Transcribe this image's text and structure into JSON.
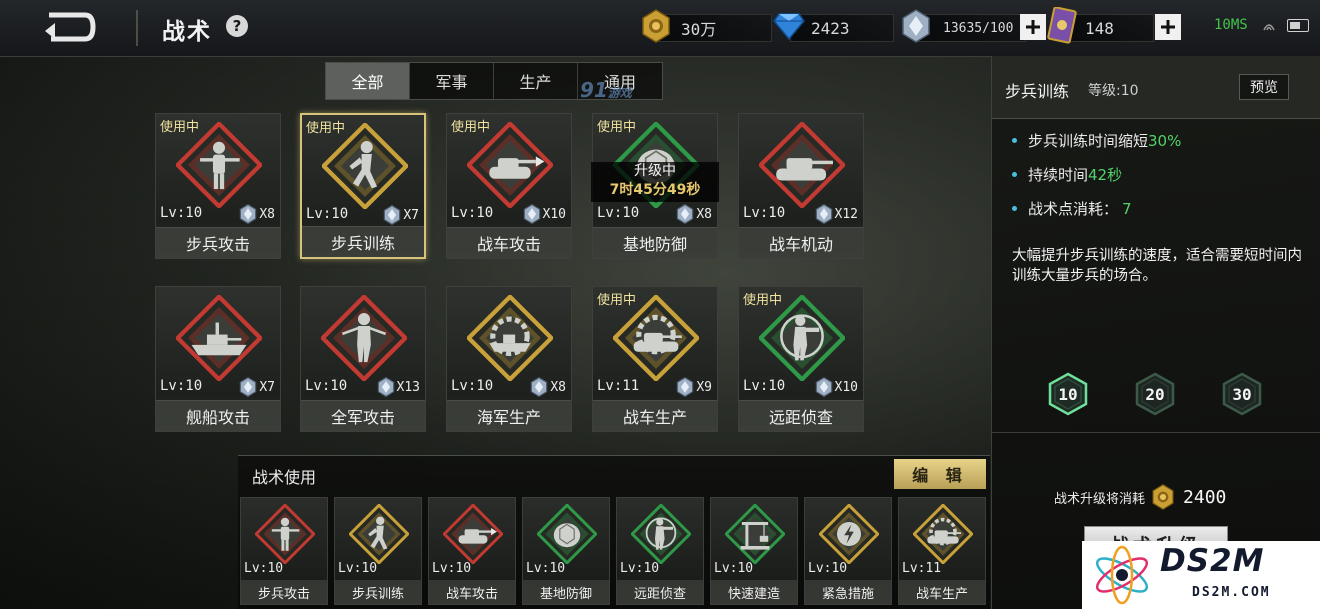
{
  "header": {
    "title": "战术",
    "help_label": "?",
    "resources": {
      "gold": "30万",
      "diamond": "2423",
      "crystal": "13635/100",
      "cards": "148"
    },
    "latency": "10MS"
  },
  "tabs": [
    {
      "label": "全部",
      "active": true
    },
    {
      "label": "军事",
      "active": false
    },
    {
      "label": "生产",
      "active": false
    },
    {
      "label": "通用",
      "active": false
    }
  ],
  "watermark_91": {
    "main": "91",
    "sub": "游戏"
  },
  "tactics": [
    {
      "name": "步兵攻击",
      "lv": "Lv:10",
      "cost": "X8",
      "in_use": "使用中",
      "frame": "red",
      "icon": "soldier-rifle-icon",
      "selected": false
    },
    {
      "name": "步兵训练",
      "lv": "Lv:10",
      "cost": "X7",
      "in_use": "使用中",
      "frame": "gold",
      "icon": "running-soldier-icon",
      "selected": true
    },
    {
      "name": "战车攻击",
      "lv": "Lv:10",
      "cost": "X10",
      "in_use": "使用中",
      "frame": "red",
      "icon": "tank-fire-icon",
      "selected": false
    },
    {
      "name": "基地防御",
      "lv": "Lv:10",
      "cost": "X8",
      "in_use": "使用中",
      "frame": "green",
      "icon": "turtle-shield-icon",
      "selected": false,
      "upgrading": {
        "label": "升级中",
        "timer": "7时45分49秒"
      }
    },
    {
      "name": "战车机动",
      "lv": "Lv:10",
      "cost": "X12",
      "in_use": "",
      "frame": "red",
      "icon": "tank-icon",
      "selected": false
    },
    {
      "name": "舰船攻击",
      "lv": "Lv:10",
      "cost": "X7",
      "in_use": "",
      "frame": "red",
      "icon": "warship-icon",
      "selected": false
    },
    {
      "name": "全军攻击",
      "lv": "Lv:10",
      "cost": "X13",
      "in_use": "",
      "frame": "red",
      "icon": "soldier-woman-icon",
      "selected": false
    },
    {
      "name": "海军生产",
      "lv": "Lv:10",
      "cost": "X8",
      "in_use": "",
      "frame": "gold",
      "icon": "ship-gear-icon",
      "selected": false
    },
    {
      "name": "战车生产",
      "lv": "Lv:11",
      "cost": "X9",
      "in_use": "使用中",
      "frame": "gold",
      "icon": "tank-gear-icon",
      "selected": false
    },
    {
      "name": "远距侦查",
      "lv": "Lv:10",
      "cost": "X10",
      "in_use": "使用中",
      "frame": "green",
      "icon": "scout-soldier-icon",
      "selected": false
    }
  ],
  "usage": {
    "title": "战术使用",
    "edit_label": "编 辑",
    "slots": [
      {
        "name": "步兵攻击",
        "lv": "Lv:10",
        "frame": "red",
        "icon": "soldier-rifle-icon"
      },
      {
        "name": "步兵训练",
        "lv": "Lv:10",
        "frame": "gold",
        "icon": "running-soldier-icon"
      },
      {
        "name": "战车攻击",
        "lv": "Lv:10",
        "frame": "red",
        "icon": "tank-fire-icon"
      },
      {
        "name": "基地防御",
        "lv": "Lv:10",
        "frame": "green",
        "icon": "turtle-shield-icon"
      },
      {
        "name": "远距侦查",
        "lv": "Lv:10",
        "frame": "green",
        "icon": "scout-soldier-icon"
      },
      {
        "name": "快速建造",
        "lv": "Lv:10",
        "frame": "green",
        "icon": "crane-icon"
      },
      {
        "name": "紧急措施",
        "lv": "Lv:10",
        "frame": "gold",
        "icon": "lightning-shield-icon"
      },
      {
        "name": "战车生产",
        "lv": "Lv:11",
        "frame": "gold",
        "icon": "tank-gear-icon"
      }
    ]
  },
  "detail": {
    "name": "步兵训练",
    "level_label": "等级:10",
    "preview_label": "预览",
    "effects": [
      {
        "text": "步兵训练时间缩短",
        "highlight": "30%"
      },
      {
        "text": "持续时间",
        "highlight": "42秒"
      },
      {
        "text": "战术点消耗：",
        "highlight": "7"
      }
    ],
    "description": "大幅提升步兵训练的速度，适合需要短时间内训练大量步兵的场合。",
    "level_buttons": [
      "10",
      "20",
      "30"
    ],
    "upgrade_cost_label": "战术升级将消耗",
    "upgrade_cost": "2400",
    "upgrade_button": "战术升级"
  },
  "watermark_ds2m": {
    "big": "DS2M",
    "small": "DS2M.COM"
  },
  "colors": {
    "red": "#c23a32",
    "gold": "#c9a13a",
    "green": "#2e9a48",
    "accent": "#d7c37a",
    "highlight": "#52d26a"
  }
}
